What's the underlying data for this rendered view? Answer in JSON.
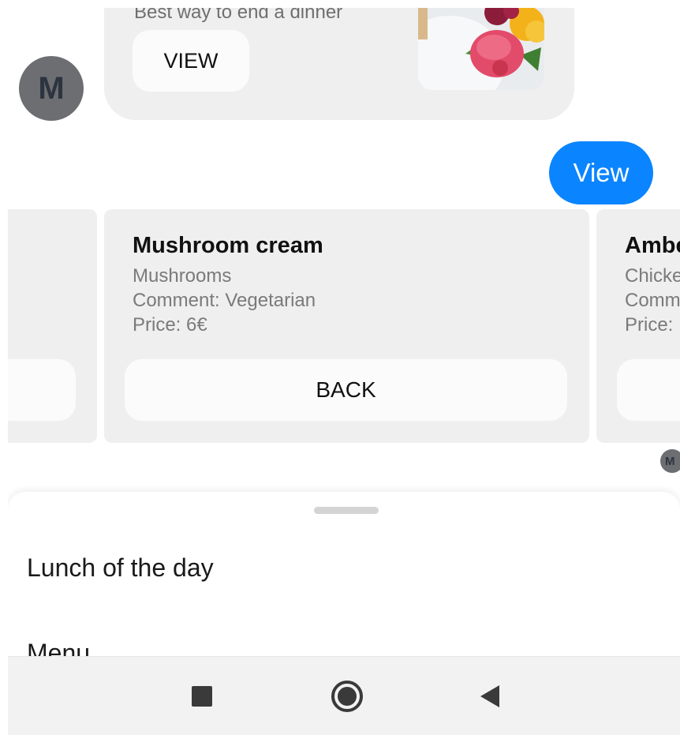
{
  "top_card": {
    "description": "Best way to end a dinner",
    "view_label": "VIEW",
    "image_icon": "dessert-photo"
  },
  "bot_avatar": {
    "initial": "M"
  },
  "user_message": {
    "text": "View"
  },
  "carousel": {
    "left_card": {
      "button_label": ""
    },
    "center_card": {
      "title": "Mushroom cream",
      "ingredients": "Mushrooms",
      "comment": " Comment: Vegetarian",
      "price": " Price: 6€",
      "button_label": "BACK"
    },
    "right_card": {
      "title": "Ambe",
      "ingredients": "Chicke",
      "comment": " Comm",
      "price": " Price:"
    }
  },
  "small_avatar": {
    "initial": "M"
  },
  "bottom_sheet": {
    "items": [
      "Lunch of the day",
      "Menu"
    ]
  },
  "navbar": {
    "icons": [
      "recents-square-icon",
      "home-circle-icon",
      "back-triangle-icon"
    ]
  },
  "colors": {
    "accent": "#0a84ff",
    "card_bg": "#efefef",
    "button_bg": "#fbfbfb",
    "avatar_bg": "#6c6e72"
  }
}
